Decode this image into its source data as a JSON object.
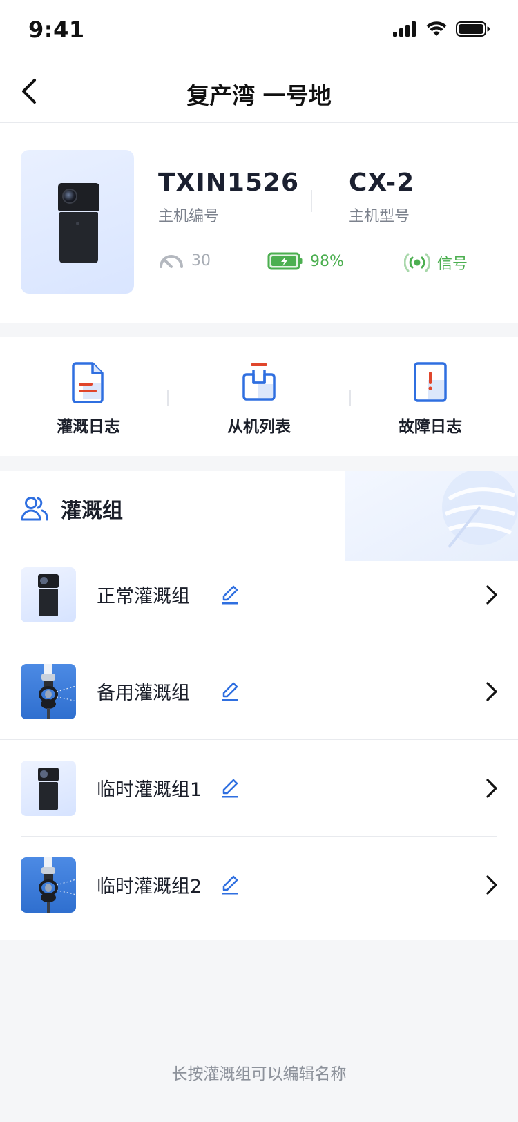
{
  "status_bar": {
    "time": "9:41"
  },
  "nav": {
    "title": "复产湾 一号地",
    "back_icon": "chevron-left-icon"
  },
  "device": {
    "id_value": "TXIN1526",
    "id_label": "主机编号",
    "model_value": "CX-2",
    "model_label": "主机型号",
    "speed_value": "30",
    "battery_value": "98%",
    "signal_label": "信号",
    "colors": {
      "green": "#4caf50",
      "gray": "#b4b8bf"
    }
  },
  "quick_actions": [
    {
      "label": "灌溉日志",
      "icon": "irrigation-log-icon"
    },
    {
      "label": "从机列表",
      "icon": "slave-list-icon"
    },
    {
      "label": "故障日志",
      "icon": "fault-log-icon"
    }
  ],
  "groups": {
    "title": "灌溉组",
    "items": [
      {
        "name": "正常灌溉组",
        "thumb": "camera"
      },
      {
        "name": "备用灌溉组",
        "thumb": "sprinkler"
      },
      {
        "name": "临时灌溉组1",
        "thumb": "camera"
      },
      {
        "name": "临时灌溉组2",
        "thumb": "sprinkler"
      }
    ]
  },
  "hint": "长按灌溉组可以编辑名称",
  "accent_color": "#2f6fe0"
}
